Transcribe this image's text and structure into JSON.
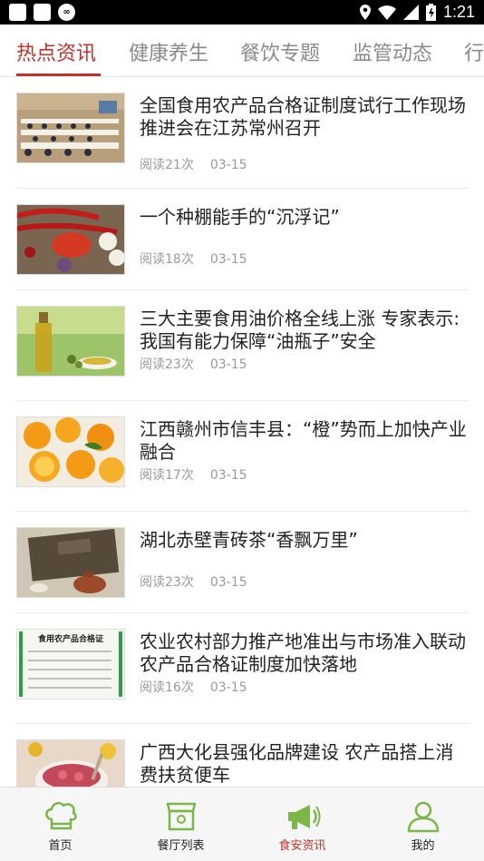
{
  "status": {
    "time": "1:21"
  },
  "tabs": [
    "热点资讯",
    "健康养生",
    "餐饮专题",
    "监管动态",
    "行"
  ],
  "articles": [
    {
      "title": "全国食用农产品合格证制度试行工作现场推进会在江苏常州召开",
      "reads": "阅读21次",
      "date": "03-15",
      "image": "conference-photo"
    },
    {
      "title": "一个种棚能手的“沉浮记”",
      "reads": "阅读18次",
      "date": "03-15",
      "image": "chili-garlic-photo"
    },
    {
      "title": "三大主要食用油价格全线上涨 专家表示:我国有能力保障“油瓶子”安全",
      "reads": "阅读23次",
      "date": "03-15",
      "image": "olive-oil-photo"
    },
    {
      "title": "江西赣州市信丰县：“橙”势而上加快产业融合",
      "reads": "阅读17次",
      "date": "03-15",
      "image": "oranges-photo"
    },
    {
      "title": "湖北赤壁青砖茶“香飘万里”",
      "reads": "阅读23次",
      "date": "03-15",
      "image": "brick-tea-photo"
    },
    {
      "title": "农业农村部力推产地准出与市场准入联动 农产品合格证制度加快落地",
      "reads": "阅读16次",
      "date": "03-15",
      "image": "certificate-photo",
      "image_text": "食用农产品合格证"
    },
    {
      "title": "广西大化县强化品牌建设 农产品搭上消费扶贫便车",
      "reads": "",
      "date": "",
      "image": "fruit-bowl-photo"
    }
  ],
  "bottom_nav": [
    {
      "label": "首页",
      "icon": "chef-hat-icon"
    },
    {
      "label": "餐厅列表",
      "icon": "restaurant-icon"
    },
    {
      "label": "食安资讯",
      "icon": "megaphone-icon"
    },
    {
      "label": "我的",
      "icon": "user-icon"
    }
  ],
  "colors": {
    "accent": "#c0322c",
    "nav_icon": "#7ab648"
  }
}
